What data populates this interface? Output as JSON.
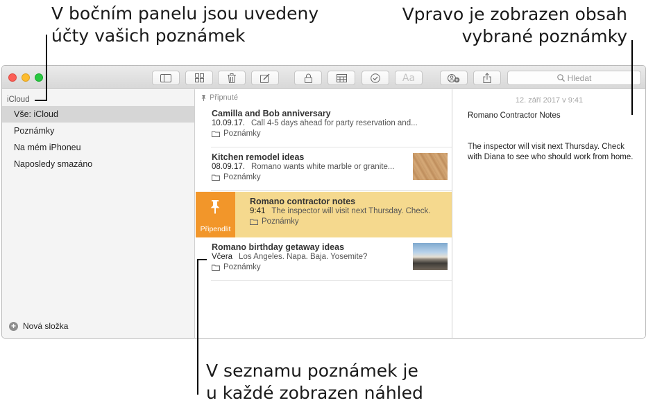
{
  "callouts": {
    "top_left": [
      "V bočním panelu jsou uvedeny",
      "účty vašich poznámek"
    ],
    "top_right": [
      "Vpravo je zobrazen obsah",
      "vybrané poznámky"
    ],
    "bottom": [
      "V seznamu poznámek je",
      "u každé zobrazen náhled"
    ]
  },
  "toolbar": {
    "icons": [
      "sidebar-icon",
      "gallery-icon",
      "trash-icon",
      "compose-icon",
      "lock-icon",
      "table-icon",
      "checklist-icon",
      "format-text-icon",
      "add-people-icon",
      "share-icon"
    ],
    "format_label": "Aa",
    "search_placeholder": "Hledat"
  },
  "sidebar": {
    "account": "iCloud",
    "items": [
      {
        "label": "Vše: iCloud",
        "selected": true
      },
      {
        "label": "Poznámky",
        "selected": false
      },
      {
        "label": "Na mém iPhoneu",
        "selected": false
      },
      {
        "label": "Naposledy smazáno",
        "selected": false
      }
    ],
    "new_folder": "Nová složka"
  },
  "notes": {
    "pinned_header": "Připnuté",
    "items": [
      {
        "title": "Camilla and Bob anniversary",
        "date": "10.09.17.",
        "preview": "Call 4-5 days ahead for party reservation and...",
        "folder": "Poznámky"
      },
      {
        "title": "Kitchen remodel ideas",
        "date": "08.09.17.",
        "preview": "Romano wants white marble or granite...",
        "folder": "Poznámky"
      },
      {
        "title": "Romano contractor notes",
        "date": "9:41",
        "preview": "The inspector will visit next Thursday. Check.",
        "folder": "Poznámky"
      },
      {
        "title": "Romano birthday getaway ideas",
        "date": "Včera",
        "preview": "Los Angeles. Napa. Baja. Yosemite?",
        "folder": "Poznámky"
      }
    ],
    "pin_action": "Připendlit"
  },
  "detail": {
    "date": "12. září 2017 v 9:41",
    "title": "Romano Contractor Notes",
    "body": "The inspector will visit next Thursday. Check with Diana to see who should work from home."
  },
  "colors": {
    "selected_note": "#f5d98e",
    "pin_action": "#f2962a",
    "sidebar_selected": "#d6d6d6"
  }
}
